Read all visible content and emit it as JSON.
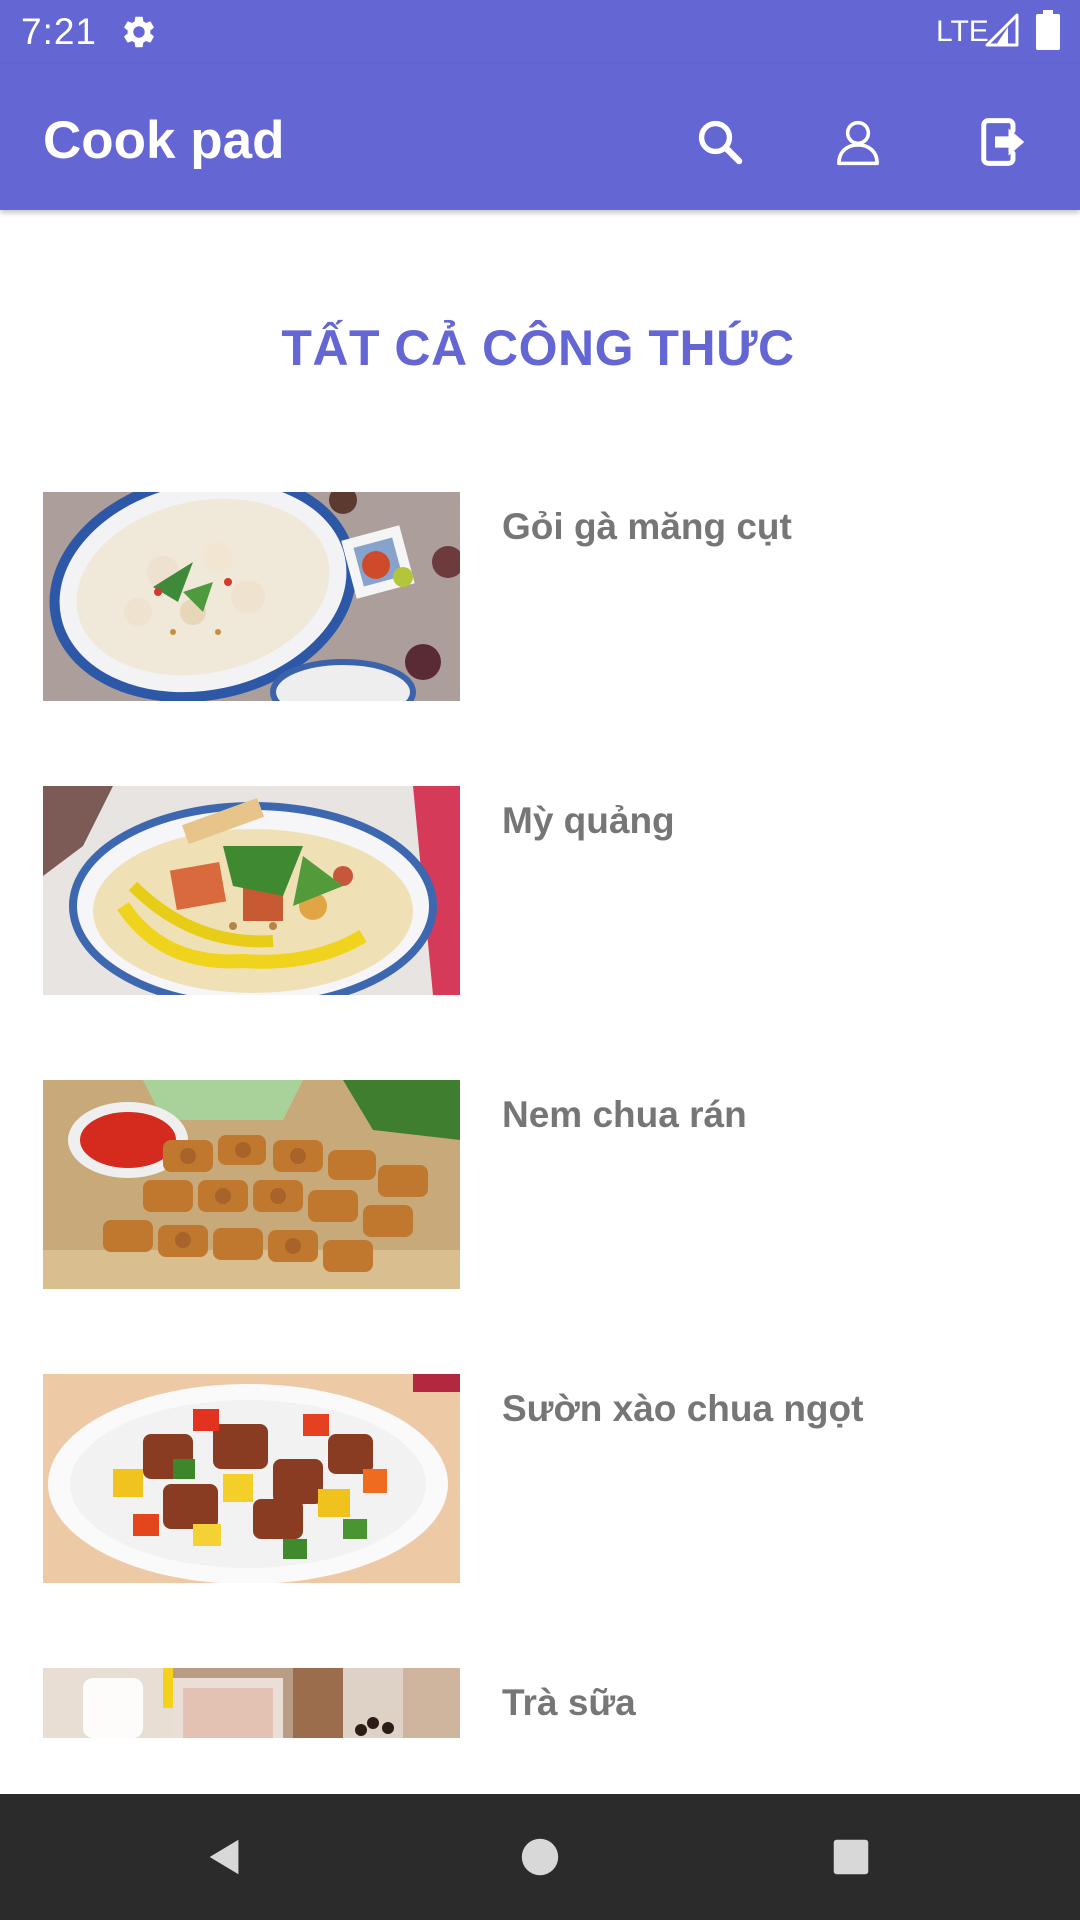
{
  "status_bar": {
    "time": "7:21",
    "network": "LTE",
    "icons": [
      "settings-gear-icon",
      "cell-signal-icon",
      "battery-icon"
    ]
  },
  "app_bar": {
    "title": "Cook pad",
    "actions": [
      "search-icon",
      "account-icon",
      "logout-icon"
    ]
  },
  "page": {
    "heading": "TẤT CẢ CÔNG THỨC"
  },
  "recipes": [
    {
      "name": "Gỏi gà măng cụt"
    },
    {
      "name": "Mỳ quảng"
    },
    {
      "name": "Nem chua rán"
    },
    {
      "name": "Sườn xào chua ngọt"
    },
    {
      "name": "Trà sữa"
    }
  ],
  "nav_bar": {
    "buttons": [
      "back-icon",
      "home-icon",
      "recents-icon"
    ]
  },
  "colors": {
    "primary": "#6366d3",
    "recipe_text": "#767676",
    "nav_bar": "#2b2b2b"
  }
}
